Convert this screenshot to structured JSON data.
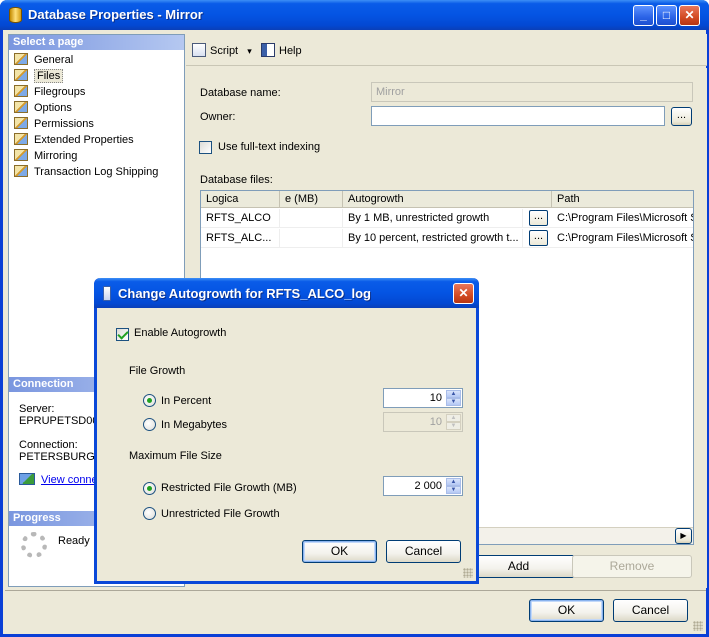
{
  "window": {
    "title": "Database Properties - Mirror",
    "buttons": {
      "minimize": "_",
      "maximize": "□",
      "close": "✕"
    }
  },
  "left_pane": {
    "header": "Select a page",
    "pages": [
      {
        "label": "General"
      },
      {
        "label": "Files"
      },
      {
        "label": "Filegroups"
      },
      {
        "label": "Options"
      },
      {
        "label": "Permissions"
      },
      {
        "label": "Extended Properties"
      },
      {
        "label": "Mirroring"
      },
      {
        "label": "Transaction Log Shipping"
      }
    ],
    "selected_index": 1,
    "connection": {
      "header": "Connection",
      "server_label": "Server:",
      "server_value": "EPRUPETSD00",
      "connection_label": "Connection:",
      "connection_value": "PETERSBURG\\",
      "view_link": "View conne"
    },
    "progress": {
      "header": "Progress",
      "status": "Ready"
    }
  },
  "toolbar": {
    "script": "Script",
    "dropdown_arrow": "▾",
    "help": "Help"
  },
  "form": {
    "db_name_label": "Database name:",
    "db_name_value": "Mirror",
    "owner_label": "Owner:",
    "owner_value": "",
    "owner_browse": "...",
    "fulltext_label": "Use full-text indexing",
    "fulltext_checked": false,
    "files_label": "Database files:"
  },
  "grid": {
    "columns": [
      "Logica",
      "e (MB)",
      "Autogrowth",
      "Path"
    ],
    "rows": [
      {
        "logical": "RFTS_ALCO",
        "size": "",
        "autogrowth": "By 1 MB, unrestricted growth",
        "btn": "...",
        "path": "C:\\Program Files\\Microsoft S"
      },
      {
        "logical": "RFTS_ALC...",
        "size": "",
        "autogrowth": "By 10 percent, restricted growth t...",
        "btn": "...",
        "path": "C:\\Program Files\\Microsoft S"
      }
    ],
    "scroll_right": "▶"
  },
  "actions": {
    "add": "Add",
    "remove": "Remove"
  },
  "bottom": {
    "ok": "OK",
    "cancel": "Cancel"
  },
  "dialog": {
    "title": "Change Autogrowth for RFTS_ALCO_log",
    "close": "✕",
    "enable_label": "Enable Autogrowth",
    "enable_checked": true,
    "file_growth_header": "File Growth",
    "in_percent_label": "In Percent",
    "in_percent_value": "10",
    "in_mb_label": "In Megabytes",
    "in_mb_value": "10",
    "max_size_header": "Maximum File Size",
    "restricted_label": "Restricted File Growth (MB)",
    "restricted_value": "2 000",
    "unrestricted_label": "Unrestricted File Growth",
    "ok": "OK",
    "cancel": "Cancel",
    "spin_up": "▲",
    "spin_down": "▼"
  }
}
